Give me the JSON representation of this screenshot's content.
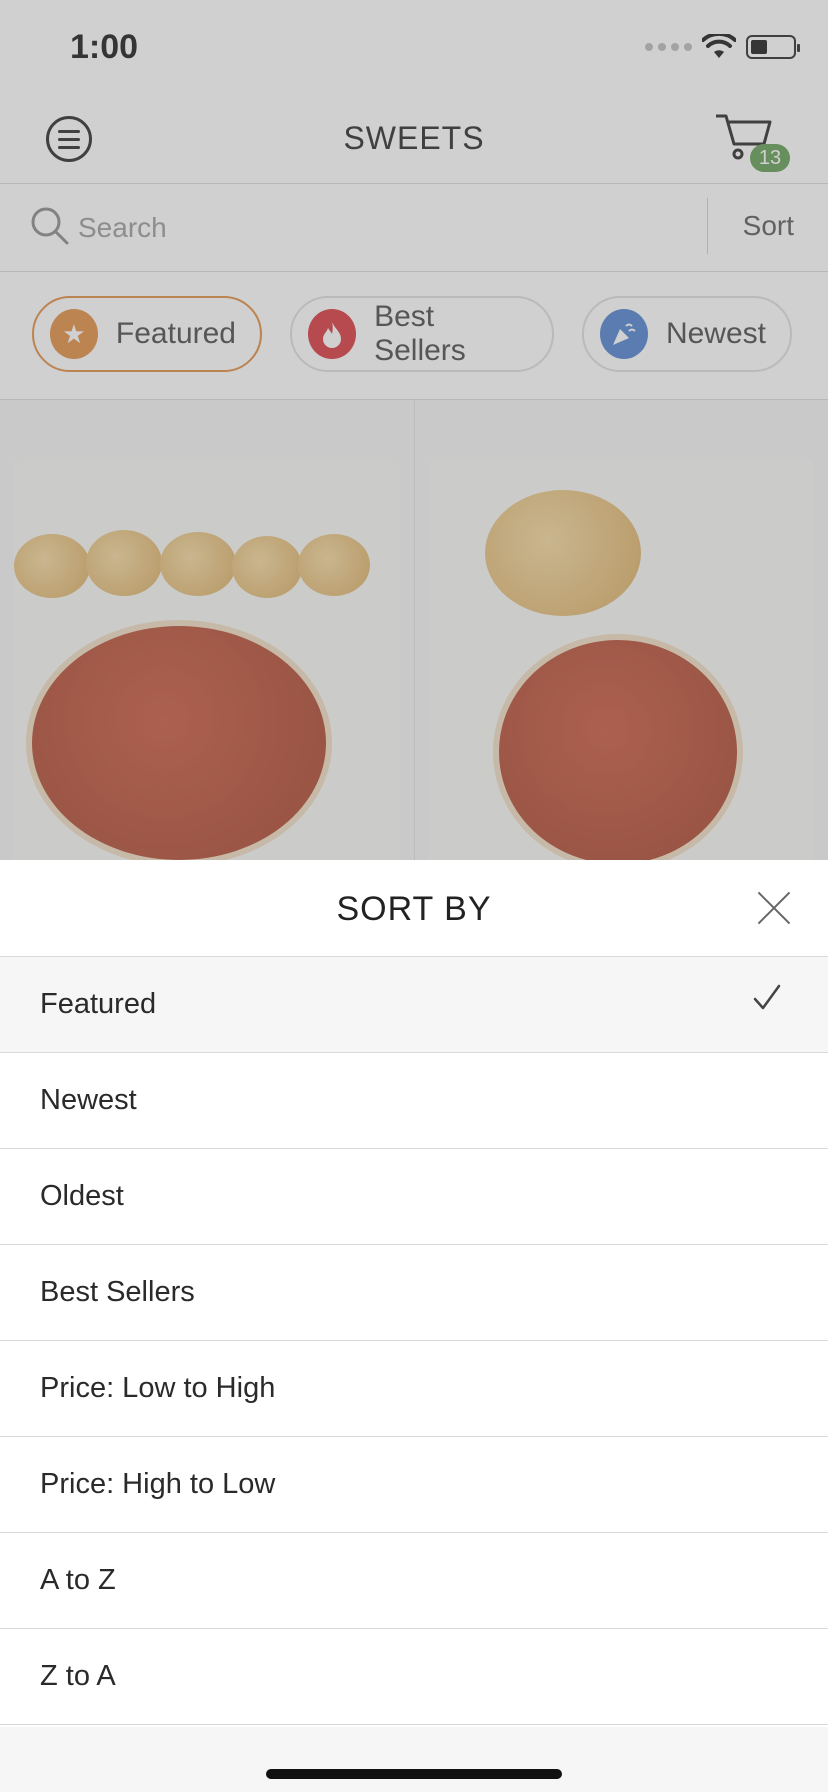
{
  "status_bar": {
    "time": "1:00"
  },
  "nav": {
    "title": "SWEETS",
    "cart_count": "13"
  },
  "search": {
    "placeholder": "Search",
    "sort_label": "Sort"
  },
  "chips": [
    {
      "label": "Featured",
      "icon": "star-icon",
      "color": "#e08a3c"
    },
    {
      "label": "Best Sellers",
      "icon": "flame-icon",
      "color": "#d7323a"
    },
    {
      "label": "Newest",
      "icon": "party-icon",
      "color": "#4a7fcf"
    }
  ],
  "sort_sheet": {
    "title": "SORT BY",
    "options": [
      {
        "label": "Featured",
        "selected": true
      },
      {
        "label": "Newest"
      },
      {
        "label": "Oldest"
      },
      {
        "label": "Best Sellers"
      },
      {
        "label": "Price: Low to High"
      },
      {
        "label": "Price: High to Low"
      },
      {
        "label": "A to Z"
      },
      {
        "label": "Z to A"
      }
    ]
  }
}
